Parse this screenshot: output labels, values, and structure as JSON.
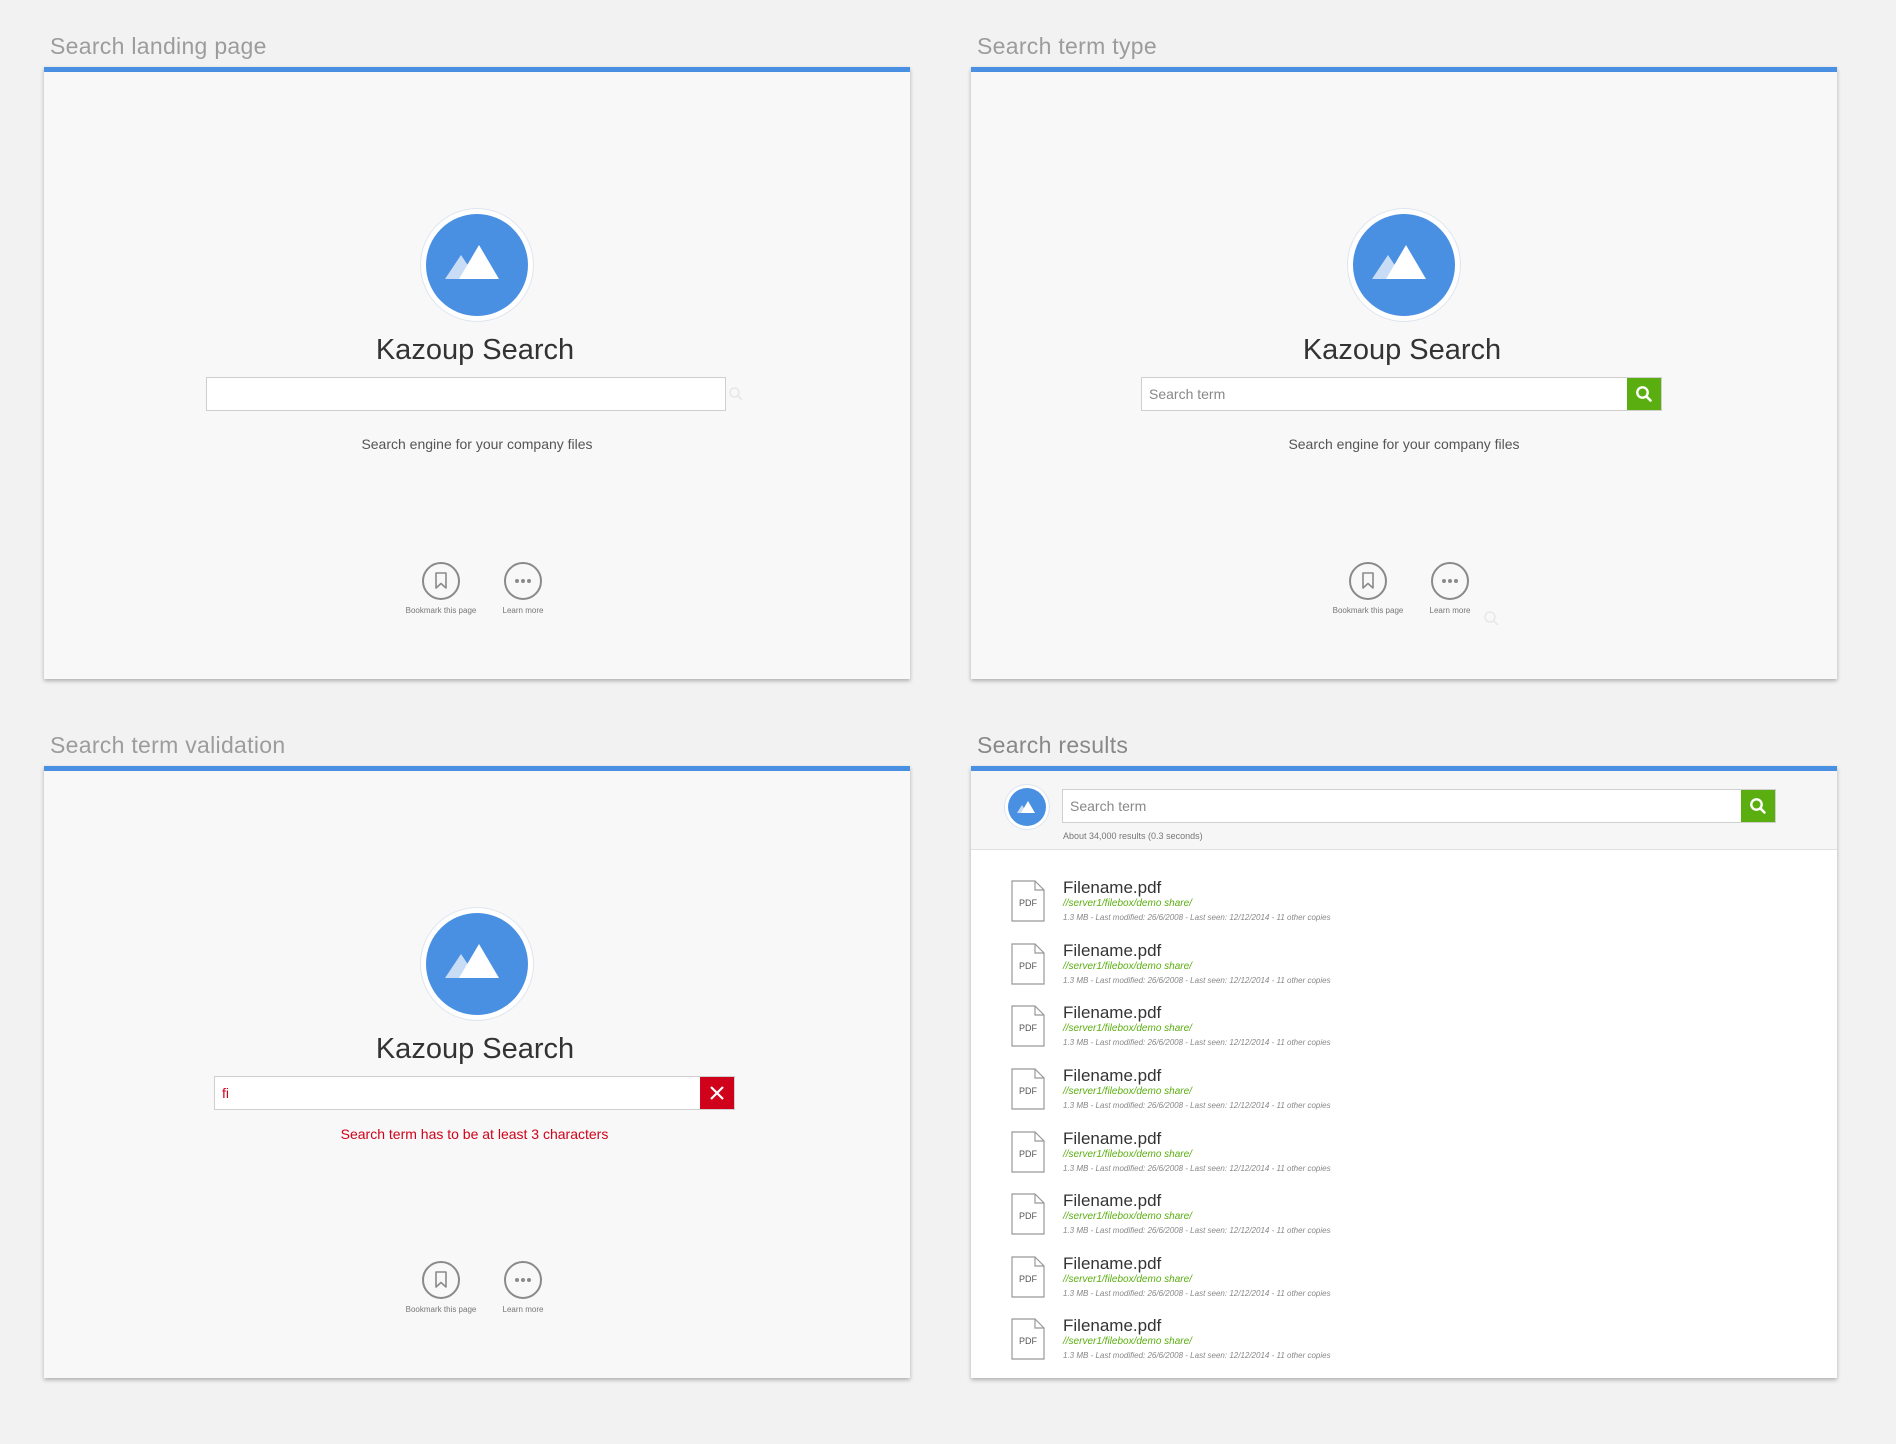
{
  "panels": {
    "landing": {
      "title": "Search landing page",
      "brand": "Kazoup Search",
      "input_value": "",
      "tagline": "Search engine for your company files",
      "bookmark_label": "Bookmark this page",
      "learn_label": "Learn more"
    },
    "typing": {
      "title": "Search term type",
      "brand": "Kazoup Search",
      "placeholder": "Search term",
      "tagline": "Search engine for your company files",
      "bookmark_label": "Bookmark this page",
      "learn_label": "Learn more"
    },
    "validation": {
      "title": "Search term validation",
      "brand": "Kazoup Search",
      "input_value": "fi",
      "error": "Search term has to be at least 3 characters",
      "bookmark_label": "Bookmark this page",
      "learn_label": "Learn more"
    },
    "results": {
      "title": "Search results",
      "placeholder": "Search term",
      "count": "About 34,000 results (0.3 seconds)",
      "items": [
        {
          "type": "PDF",
          "name": "Filename.pdf",
          "path": "//server1/filebox/demo share/",
          "meta": "1.3 MB - Last modified: 26/6/2008 - Last seen: 12/12/2014 - 11 other copies"
        },
        {
          "type": "PDF",
          "name": "Filename.pdf",
          "path": "//server1/filebox/demo share/",
          "meta": "1.3 MB - Last modified: 26/6/2008 - Last seen: 12/12/2014 - 11 other copies"
        },
        {
          "type": "PDF",
          "name": "Filename.pdf",
          "path": "//server1/filebox/demo share/",
          "meta": "1.3 MB - Last modified: 26/6/2008 - Last seen: 12/12/2014 - 11 other copies"
        },
        {
          "type": "PDF",
          "name": "Filename.pdf",
          "path": "//server1/filebox/demo share/",
          "meta": "1.3 MB - Last modified: 26/6/2008 - Last seen: 12/12/2014 - 11 other copies"
        },
        {
          "type": "PDF",
          "name": "Filename.pdf",
          "path": "//server1/filebox/demo share/",
          "meta": "1.3 MB - Last modified: 26/6/2008 - Last seen: 12/12/2014 - 11 other copies"
        },
        {
          "type": "PDF",
          "name": "Filename.pdf",
          "path": "//server1/filebox/demo share/",
          "meta": "1.3 MB - Last modified: 26/6/2008 - Last seen: 12/12/2014 - 11 other copies"
        },
        {
          "type": "PDF",
          "name": "Filename.pdf",
          "path": "//server1/filebox/demo share/",
          "meta": "1.3 MB - Last modified: 26/6/2008 - Last seen: 12/12/2014 - 11 other copies"
        },
        {
          "type": "PDF",
          "name": "Filename.pdf",
          "path": "//server1/filebox/demo share/",
          "meta": "1.3 MB - Last modified: 26/6/2008 - Last seen: 12/12/2014 - 11 other copies"
        }
      ]
    }
  },
  "icons": {
    "logo": "mountain-icon",
    "search": "search-icon",
    "clear": "close-icon",
    "bookmark": "bookmark-icon",
    "more": "more-dots-icon",
    "file": "pdf-file-icon"
  },
  "colors": {
    "accent": "#4a90e2",
    "success": "#5aae0f",
    "error": "#d0021b"
  }
}
